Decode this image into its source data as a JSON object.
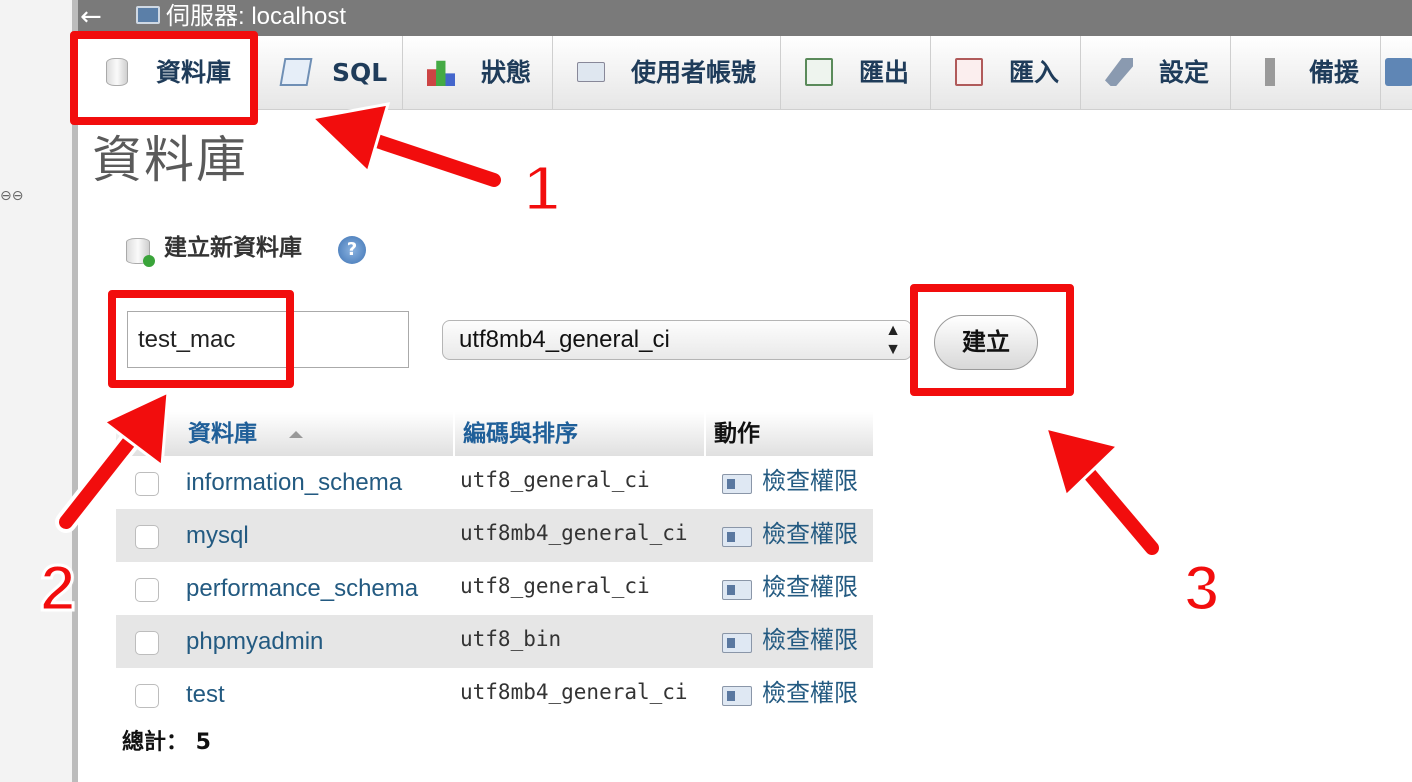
{
  "topbar": {
    "back_glyph": "←",
    "server_label": "伺服器: localhost",
    "server_icon": "server-icon"
  },
  "tabs": [
    {
      "label": "資料庫",
      "icon": "database-icon",
      "active": true
    },
    {
      "label": "SQL",
      "icon": "sql-icon"
    },
    {
      "label": "狀態",
      "icon": "status-icon"
    },
    {
      "label": "使用者帳號",
      "icon": "users-icon"
    },
    {
      "label": "匯出",
      "icon": "export-icon"
    },
    {
      "label": "匯入",
      "icon": "import-icon"
    },
    {
      "label": "設定",
      "icon": "settings-icon"
    },
    {
      "label": "備援",
      "icon": "replication-icon"
    }
  ],
  "page_title": "資料庫",
  "create": {
    "heading": "建立新資料庫",
    "help_glyph": "?",
    "db_name_value": "test_mac",
    "collation_selected": "utf8mb4_general_ci",
    "create_button": "建立"
  },
  "table": {
    "headers": {
      "database": "資料庫",
      "collation": "編碼與排序",
      "action": "動作"
    },
    "rows": [
      {
        "name": "information_schema",
        "collation": "utf8_general_ci",
        "action": "檢查權限"
      },
      {
        "name": "mysql",
        "collation": "utf8mb4_general_ci",
        "action": "檢查權限"
      },
      {
        "name": "performance_schema",
        "collation": "utf8_general_ci",
        "action": "檢查權限"
      },
      {
        "name": "phpmyadmin",
        "collation": "utf8_bin",
        "action": "檢查權限"
      },
      {
        "name": "test",
        "collation": "utf8mb4_general_ci",
        "action": "檢查權限"
      }
    ]
  },
  "total": "總計： 5",
  "annotations": {
    "num1": "1",
    "num2": "2",
    "num3": "3",
    "color": "#f20d0d"
  }
}
